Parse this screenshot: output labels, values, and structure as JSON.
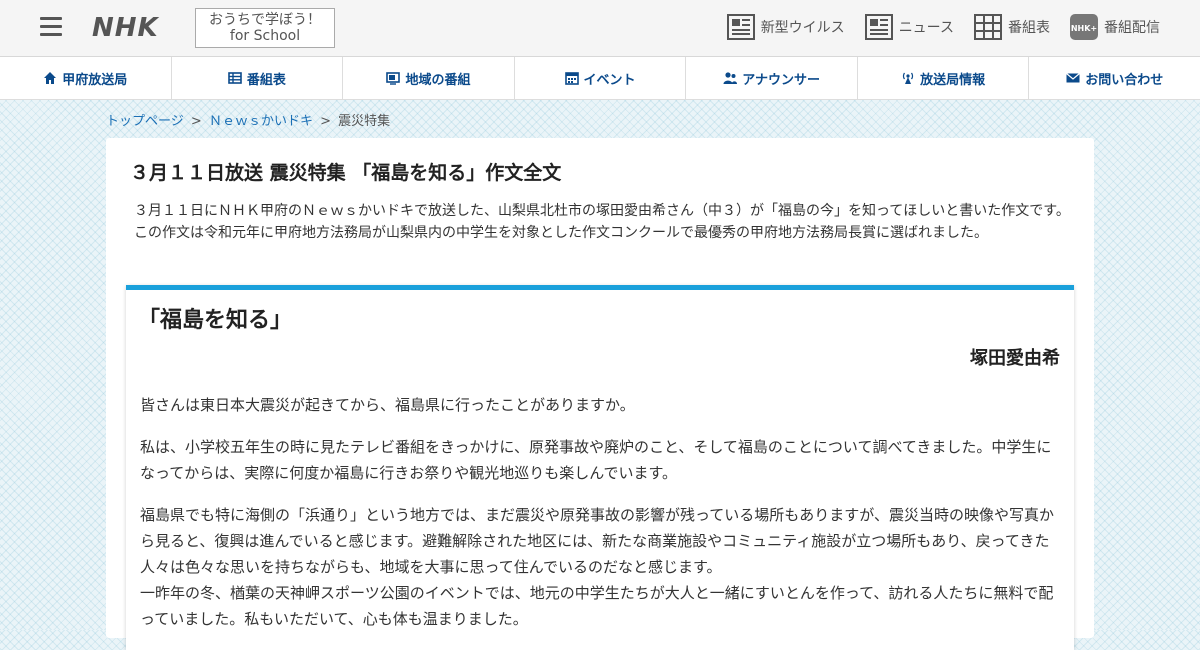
{
  "header": {
    "logo": "NHK",
    "school_line1": "おうちで学ぼう！",
    "school_line2": "for School",
    "utility": [
      {
        "label": "新型ウイルス",
        "icon": "newspaper-icon"
      },
      {
        "label": "ニュース",
        "icon": "newspaper-icon"
      },
      {
        "label": "番組表",
        "icon": "grid-icon"
      },
      {
        "label": "番組配信",
        "icon": "nhk-plus-icon"
      }
    ]
  },
  "nav": [
    {
      "label": "甲府放送局",
      "icon": "home-icon"
    },
    {
      "label": "番組表",
      "icon": "tv-guide-icon"
    },
    {
      "label": "地域の番組",
      "icon": "tv-icon"
    },
    {
      "label": "イベント",
      "icon": "calendar-icon"
    },
    {
      "label": "アナウンサー",
      "icon": "people-icon"
    },
    {
      "label": "放送局情報",
      "icon": "broadcast-icon"
    },
    {
      "label": "お問い合わせ",
      "icon": "mail-icon"
    }
  ],
  "breadcrumb": {
    "top": "トップページ",
    "news": "Ｎｅｗｓかいドキ",
    "current": "震災特集",
    "sep": ">"
  },
  "article": {
    "title": "３月１１日放送 震災特集 「福島を知る」作文全文",
    "intro1": "３月１１日にＮＨＫ甲府のＮｅｗｓかいドキで放送した、山梨県北杜市の塚田愛由希さん（中３）が「福島の今」を知ってほしいと書いた作文です。",
    "intro2": "この作文は令和元年に甲府地方法務局が山梨県内の中学生を対象とした作文コンクールで最優秀の甲府地方法務局長賞に選ばれました。",
    "essay_title": "「福島を知る」",
    "essay_author": "塚田愛由希",
    "paragraphs": [
      "皆さんは東日本大震災が起きてから、福島県に行ったことがありますか。",
      "私は、小学校五年生の時に見たテレビ番組をきっかけに、原発事故や廃炉のこと、そして福島のことについて調べてきました。中学生になってからは、実際に何度か福島に行きお祭りや観光地巡りも楽しんでいます。",
      "福島県でも特に海側の「浜通り」という地方では、まだ震災や原発事故の影響が残っている場所もありますが、震災当時の映像や写真から見ると、復興は進んでいると感じます。避難解除された地区には、新たな商業施設やコミュニティ施設が立つ場所もあり、戻ってきた人々は色々な思いを持ちながらも、地域を大事に思って住んでいるのだなと感じます。",
      "一昨年の冬、楢葉の天神岬スポーツ公園のイベントでは、地元の中学生たちが大人と一緒にすいとんを作って、訪れる人たちに無料で配っていました。私もいただいて、心も体も温まりました。"
    ]
  },
  "colors": {
    "accent": "#1aa0db",
    "nav_text": "#0b4a8b",
    "link": "#1a6fb5"
  }
}
